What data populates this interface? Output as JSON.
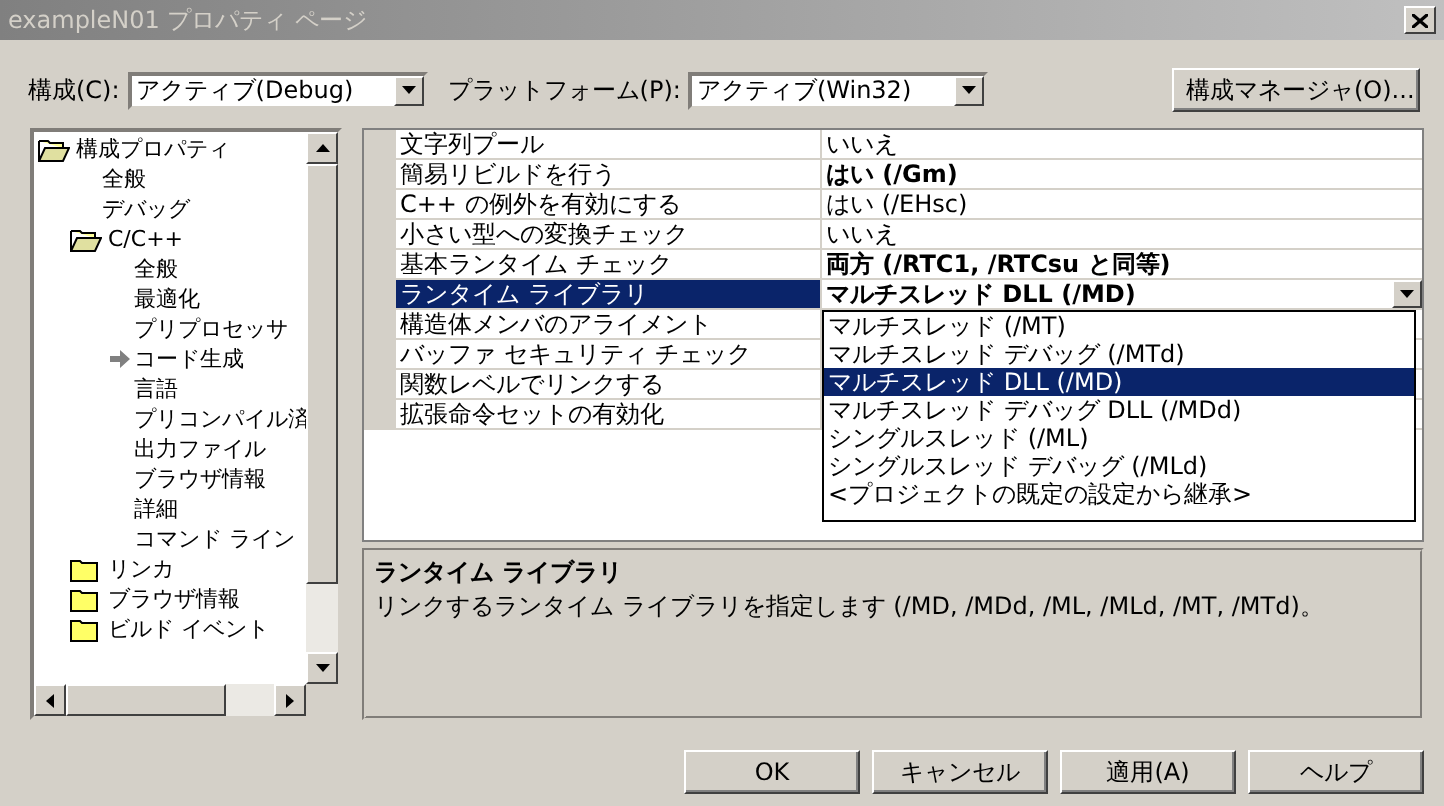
{
  "window": {
    "title": "exampleN01 プロパティ ページ"
  },
  "toolbar": {
    "configuration": {
      "label": "構成(C):",
      "value": "アクティブ(Debug)"
    },
    "platform": {
      "label": "プラットフォーム(P):",
      "value": "アクティブ(Win32)"
    },
    "manager_button": "構成マネージャ(O)..."
  },
  "tree": [
    {
      "label": "構成プロパティ",
      "kind": "folder",
      "expanded": true,
      "children": [
        {
          "label": "全般",
          "kind": "page",
          "selected": false
        },
        {
          "label": "デバッグ",
          "kind": "page",
          "selected": false
        },
        {
          "label": "C/C++",
          "kind": "folder",
          "expanded": true,
          "children": [
            {
              "label": "全般",
              "kind": "page",
              "selected": false
            },
            {
              "label": "最適化",
              "kind": "page",
              "selected": false
            },
            {
              "label": "プリプロセッサ",
              "kind": "page",
              "selected": false
            },
            {
              "label": "コード生成",
              "kind": "page",
              "selected": true
            },
            {
              "label": "言語",
              "kind": "page",
              "selected": false
            },
            {
              "label": "プリコンパイル済",
              "kind": "page",
              "selected": false
            },
            {
              "label": "出力ファイル",
              "kind": "page",
              "selected": false
            },
            {
              "label": "ブラウザ情報",
              "kind": "page",
              "selected": false
            },
            {
              "label": "詳細",
              "kind": "page",
              "selected": false
            },
            {
              "label": "コマンド ライン",
              "kind": "page",
              "selected": false
            }
          ]
        },
        {
          "label": "リンカ",
          "kind": "folder",
          "expanded": false
        },
        {
          "label": "ブラウザ情報",
          "kind": "folder",
          "expanded": false
        },
        {
          "label": "ビルド イベント",
          "kind": "folder",
          "expanded": false
        }
      ]
    }
  ],
  "properties": [
    {
      "name": "文字列プール",
      "value": "いいえ",
      "bold": false,
      "selected": false
    },
    {
      "name": "簡易リビルドを行う",
      "value": "はい (/Gm)",
      "bold": true,
      "selected": false
    },
    {
      "name": "C++ の例外を有効にする",
      "value": "はい (/EHsc)",
      "bold": false,
      "selected": false
    },
    {
      "name": "小さい型への変換チェック",
      "value": "いいえ",
      "bold": false,
      "selected": false
    },
    {
      "name": "基本ランタイム チェック",
      "value": "両方 (/RTC1, /RTCsu と同等)",
      "bold": true,
      "selected": false
    },
    {
      "name": "ランタイム ライブラリ",
      "value": "マルチスレッド DLL (/MD)",
      "bold": true,
      "selected": true
    },
    {
      "name": "構造体メンバのアライメント",
      "bold": false,
      "selected": false
    },
    {
      "name": "バッファ セキュリティ チェック",
      "bold": false,
      "selected": false
    },
    {
      "name": "関数レベルでリンクする",
      "bold": false,
      "selected": false
    },
    {
      "name": "拡張命令セットの有効化",
      "bold": false,
      "selected": false
    }
  ],
  "dropdown": {
    "options": [
      {
        "label": "マルチスレッド (/MT)",
        "selected": false
      },
      {
        "label": "マルチスレッド デバッグ (/MTd)",
        "selected": false
      },
      {
        "label": "マルチスレッド DLL (/MD)",
        "selected": true
      },
      {
        "label": "マルチスレッド デバッグ DLL (/MDd)",
        "selected": false
      },
      {
        "label": "シングルスレッド (/ML)",
        "selected": false
      },
      {
        "label": "シングルスレッド デバッグ (/MLd)",
        "selected": false
      },
      {
        "label": "<プロジェクトの既定の設定から継承>",
        "selected": false
      }
    ]
  },
  "description": {
    "title": "ランタイム ライブラリ",
    "text": "リンクするランタイム ライブラリを指定します (/MD, /MDd, /ML, /MLd, /MT, /MTd)。"
  },
  "buttons": [
    "OK",
    "キャンセル",
    "適用(A)",
    "ヘルプ"
  ]
}
